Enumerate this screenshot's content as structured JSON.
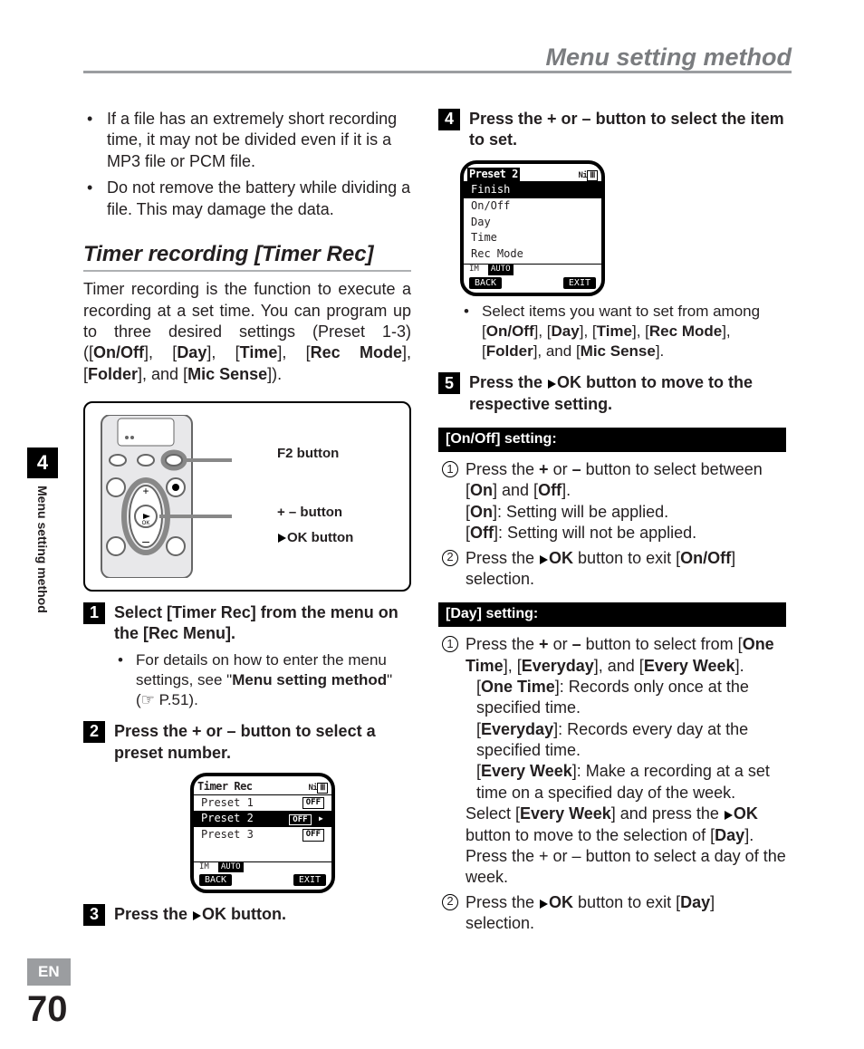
{
  "header": {
    "title": "Menu setting method"
  },
  "side": {
    "chapter": "4",
    "label": "Menu setting method"
  },
  "footer": {
    "lang": "EN",
    "page": "70"
  },
  "left": {
    "notes": [
      "If a file has an extremely short recording time, it may not be divided even if it is a MP3 file or PCM file.",
      "Do not remove the battery while dividing a file. This may damage the data."
    ],
    "section_title": "Timer recording [Timer Rec]",
    "intro_a": "Timer recording is the function to execute a recording at a set time. You can program up to three desired settings (Preset 1-3) ([",
    "intro_b": "On/Off",
    "intro_c": "], [",
    "intro_d": "Day",
    "intro_e": "], [",
    "intro_f": "Time",
    "intro_g": "], [",
    "intro_h": "Rec Mode",
    "intro_i": "], [",
    "intro_j": "Folder",
    "intro_k": "], and [",
    "intro_l": "Mic Sense",
    "intro_m": "]).",
    "device_labels": {
      "f2": "F2 button",
      "plusminus": "+ – button",
      "ok": "OK button"
    },
    "step1": {
      "num": "1",
      "a": "Select [",
      "b": "Timer Rec",
      "c": "] from the menu on the [",
      "d": "Rec Menu",
      "e": "].",
      "bullet_a": "For details on how to enter the menu settings, see \"",
      "bullet_b": "Menu setting method",
      "bullet_c": "\" (☞ P.51)."
    },
    "step2": {
      "num": "2",
      "text": "Press the + or – button to select a preset number."
    },
    "lcd1": {
      "title": "Timer Rec",
      "ni": "Ni",
      "rows": [
        "Preset 1",
        "Preset 2",
        "Preset 3"
      ],
      "off": "OFF",
      "small": [
        "IM",
        "AUTO"
      ],
      "sk_l": "BACK",
      "sk_r": "EXIT"
    },
    "step3": {
      "num": "3",
      "a": "Press the ",
      "b": "OK button."
    }
  },
  "right": {
    "step4": {
      "num": "4",
      "text": "Press the + or – button to select the item to set."
    },
    "lcd2": {
      "title": "Preset 2",
      "ni": "Ni",
      "rows": [
        "Finish",
        "On/Off",
        "Day",
        "Time",
        "Rec Mode"
      ],
      "small": [
        "IM",
        "AUTO"
      ],
      "sk_l": "BACK",
      "sk_r": "EXIT"
    },
    "step4_bullet_a": "Select items you want to set from among [",
    "step4_bullet_b": "On/Off",
    "step4_bullet_c": "], [",
    "step4_bullet_d": "Day",
    "step4_bullet_e": "], [",
    "step4_bullet_f": "Time",
    "step4_bullet_g": "], [",
    "step4_bullet_h": "Rec Mode",
    "step4_bullet_i": "], [",
    "step4_bullet_j": "Folder",
    "step4_bullet_k": "], and [",
    "step4_bullet_l": "Mic Sense",
    "step4_bullet_m": "].",
    "step5": {
      "num": "5",
      "a": "Press the ",
      "b": "OK button to move to the respective setting."
    },
    "onoff_bar": "[On/Off] setting:",
    "onoff": {
      "l1_a": "Press the ",
      "l1_b": "+",
      "l1_c": " or ",
      "l1_d": "–",
      "l1_e": " button to select between [",
      "l1_f": "On",
      "l1_g": "] and [",
      "l1_h": "Off",
      "l1_i": "].",
      "l2_a": "[",
      "l2_b": "On",
      "l2_c": "]: Setting will be applied.",
      "l3_a": "[",
      "l3_b": "Off",
      "l3_c": "]: Setting will not be applied.",
      "l4_a": "Press the ",
      "l4_b": "OK",
      "l4_c": " button to exit [",
      "l4_d": "On/Off",
      "l4_e": "] selection."
    },
    "day_bar": "[Day] setting:",
    "day": {
      "l1_a": "Press the ",
      "l1_b": "+",
      "l1_c": " or ",
      "l1_d": "–",
      "l1_e": " button to select from [",
      "l1_f": "One Time",
      "l1_g": "], [",
      "l1_h": "Everyday",
      "l1_i": "], and [",
      "l1_j": "Every Week",
      "l1_k": "].",
      "l2_a": "[",
      "l2_b": "One Time",
      "l2_c": "]: Records only once at the specified time.",
      "l3_a": "[",
      "l3_b": "Everyday",
      "l3_c": "]: Records every day at the specified time.",
      "l4_a": "[",
      "l4_b": "Every Week",
      "l4_c": "]: Make a recording at a set time on a specified day of the week.",
      "l5_a": "Select [",
      "l5_b": "Every Week",
      "l5_c": "] and press the ",
      "l5_d": "OK",
      "l5_e": " button to move to the selection of [",
      "l5_f": "Day",
      "l5_g": "]. Press the + or – button to select a day of the week.",
      "l6_a": "Press the ",
      "l6_b": "OK",
      "l6_c": " button to exit [",
      "l6_d": "Day",
      "l6_e": "] selection."
    }
  }
}
